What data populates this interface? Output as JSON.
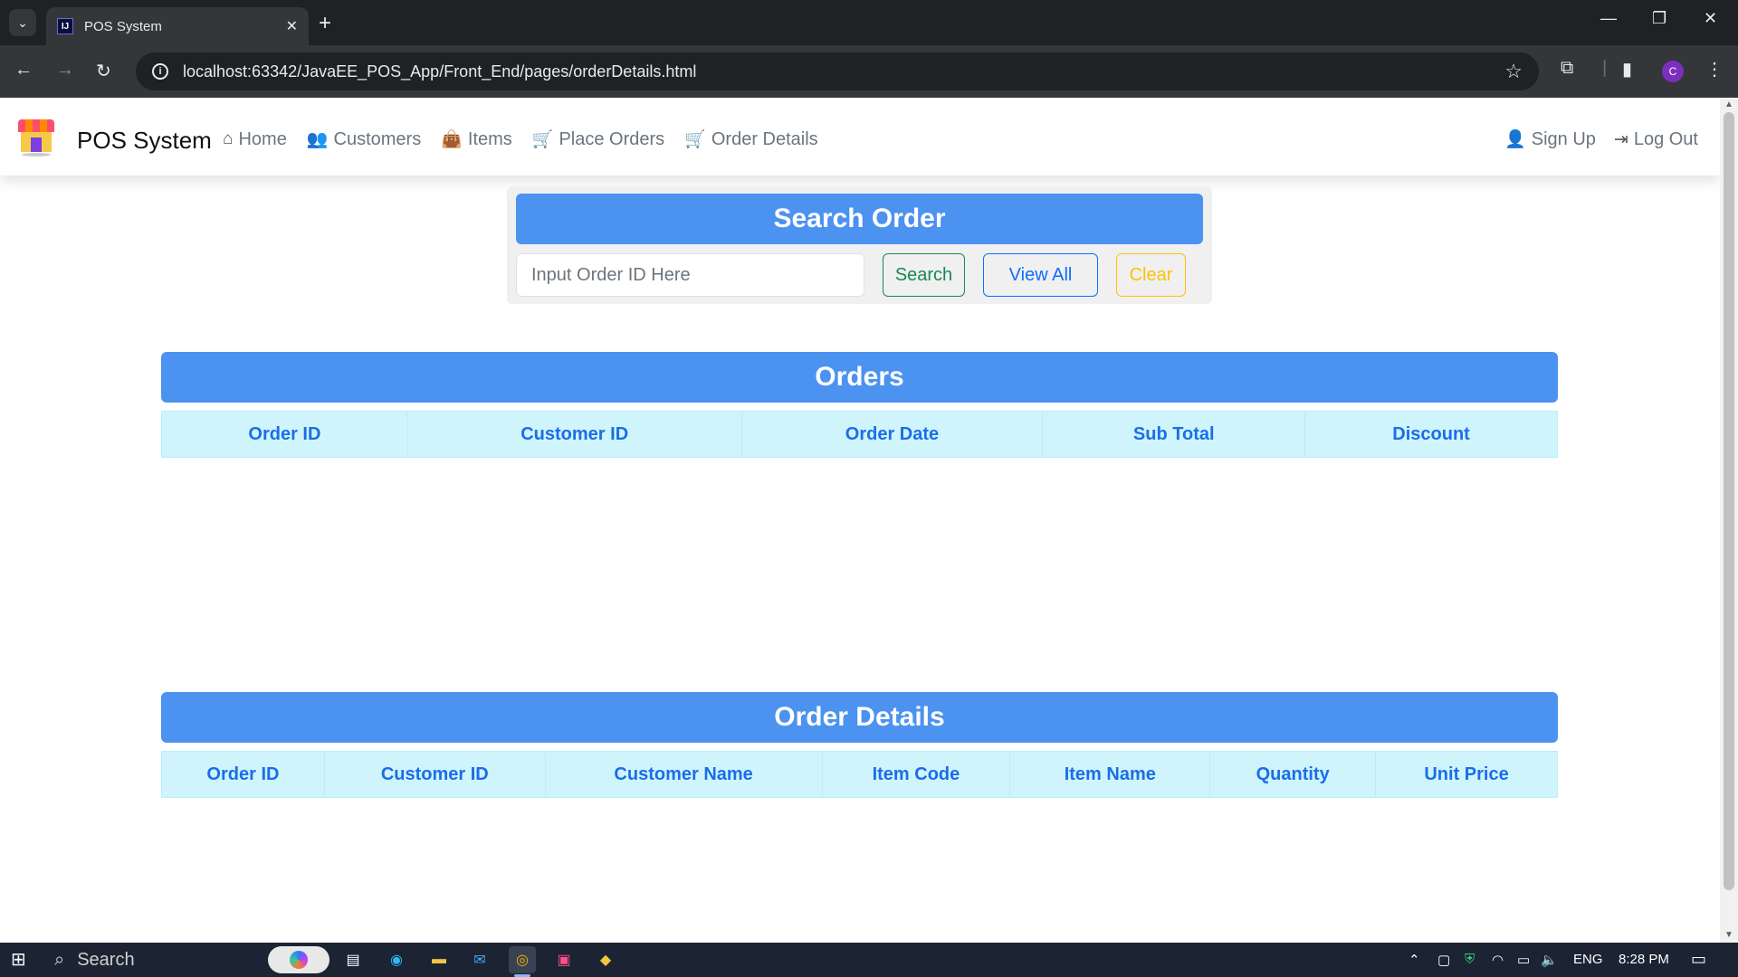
{
  "browser": {
    "tab_title": "POS System",
    "tab_favicon_text": "IJ",
    "url": "localhost:63342/JavaEE_POS_App/Front_End/pages/orderDetails.html",
    "profile_initial": "C"
  },
  "navbar": {
    "brand": "POS System",
    "links": [
      {
        "label": "Home",
        "icon": "home-icon"
      },
      {
        "label": "Customers",
        "icon": "users-icon"
      },
      {
        "label": "Items",
        "icon": "bag-icon"
      },
      {
        "label": "Place Orders",
        "icon": "cart-plus-icon"
      },
      {
        "label": "Order Details",
        "icon": "cart-icon"
      }
    ],
    "right_links": [
      {
        "label": "Sign Up",
        "icon": "user-plus-icon"
      },
      {
        "label": "Log Out",
        "icon": "logout-icon"
      }
    ]
  },
  "search": {
    "title": "Search Order",
    "placeholder": "Input Order ID Here",
    "search_label": "Search",
    "view_all_label": "View All",
    "clear_label": "Clear"
  },
  "orders": {
    "title": "Orders",
    "columns": [
      "Order ID",
      "Customer ID",
      "Order Date",
      "Sub Total",
      "Discount"
    ],
    "rows": []
  },
  "order_details": {
    "title": "Order Details",
    "columns": [
      "Order ID",
      "Customer ID",
      "Customer Name",
      "Item Code",
      "Item Name",
      "Quantity",
      "Unit Price"
    ],
    "rows": []
  },
  "taskbar": {
    "search_label": "Search",
    "language": "ENG",
    "time": "8:28 PM"
  },
  "colors": {
    "primary_header": "#4c92f0",
    "table_header_bg": "#cff4fc",
    "table_header_text": "#1a6ee8",
    "success": "#198754",
    "primary": "#0d6efd",
    "warning": "#ffc107"
  }
}
